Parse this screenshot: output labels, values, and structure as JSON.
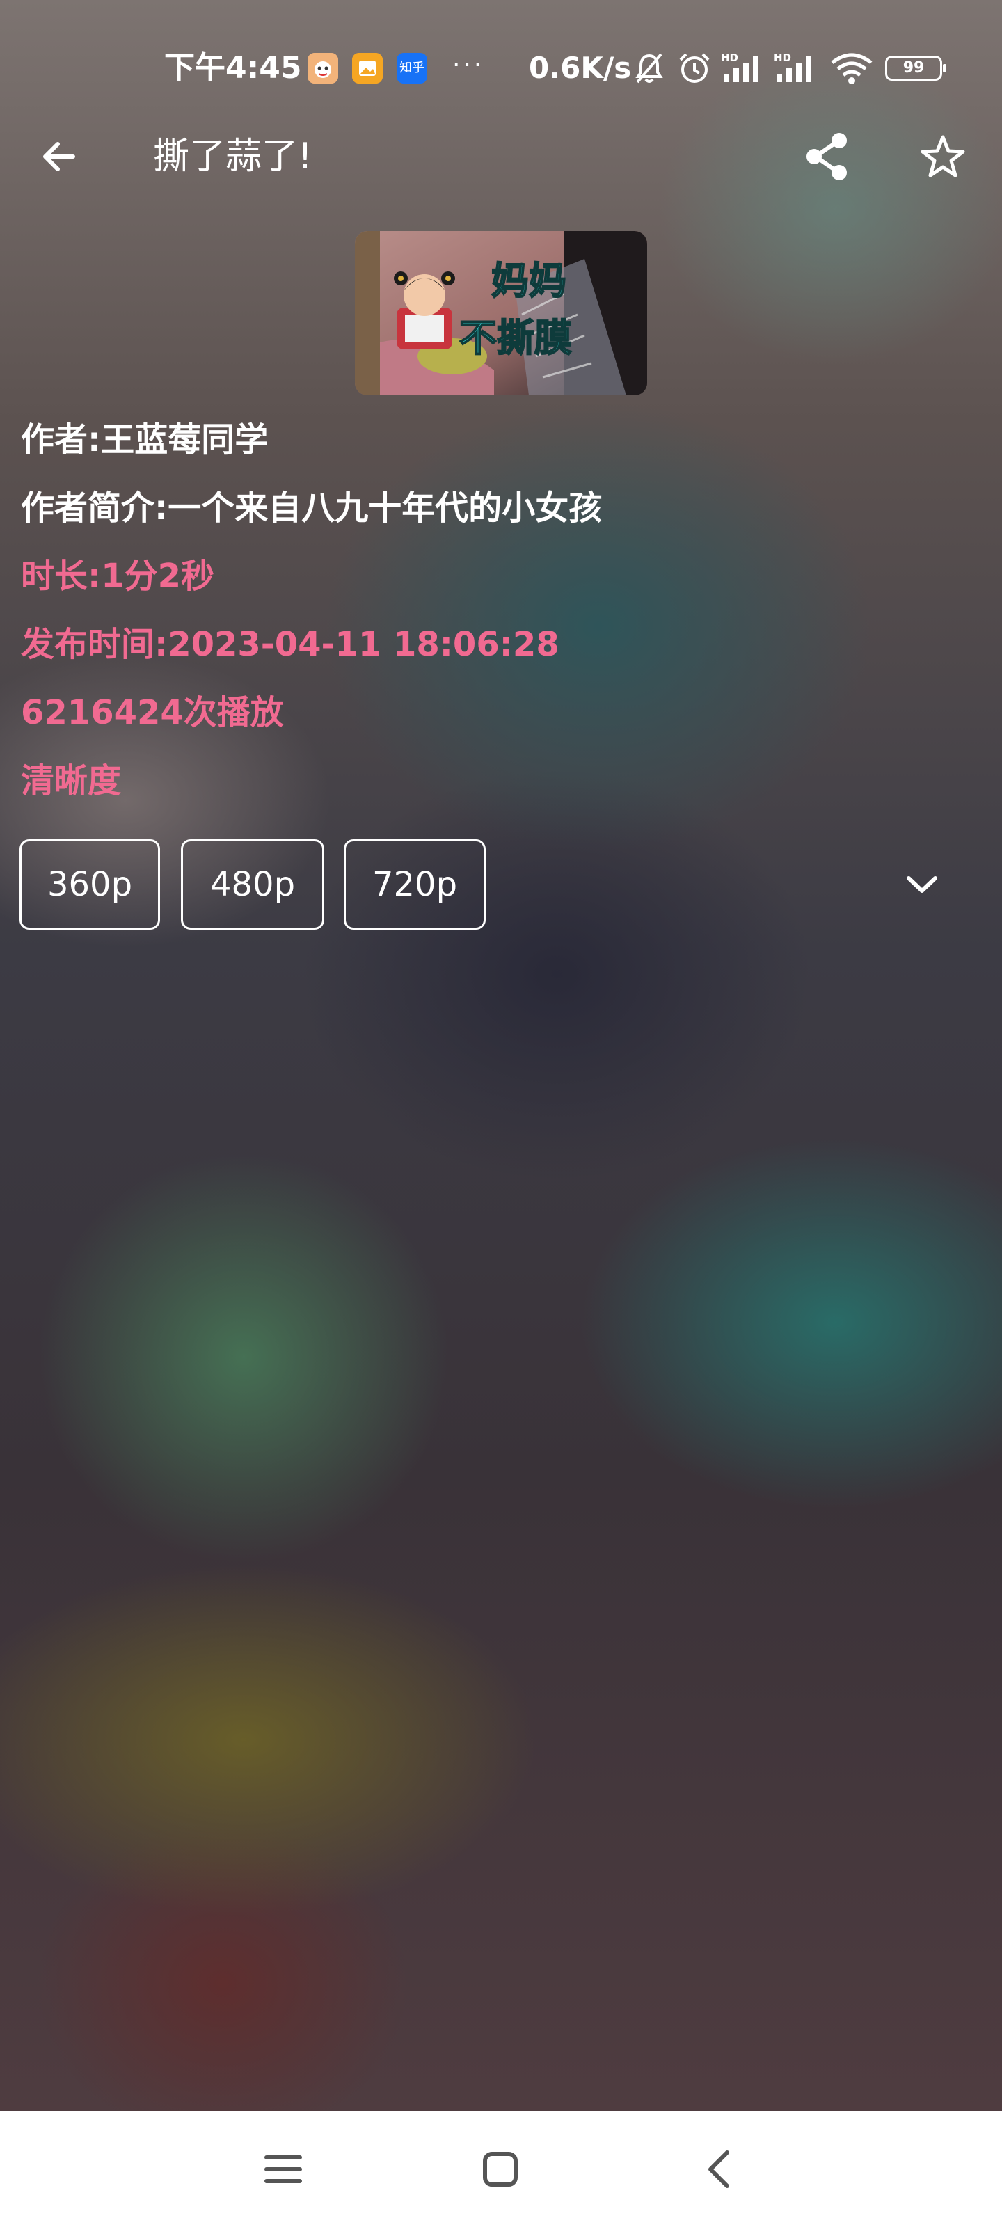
{
  "status_bar": {
    "time": "下午4:45",
    "zhihu_label": "知乎",
    "more": "···",
    "net_speed": "0.6K/s",
    "signal_label_1": "HD",
    "signal_label_2": "HD",
    "battery": "99"
  },
  "header": {
    "title": "撕了蒜了!",
    "icons": [
      "back-arrow-icon",
      "share-icon",
      "star-icon"
    ]
  },
  "thumbnail": {
    "text_line1": "妈妈",
    "text_line2": "不撕膜"
  },
  "details": {
    "author": "作者:王蓝莓同学",
    "author_bio": "作者简介:一个来自八九十年代的小女孩",
    "duration": "时长:1分2秒",
    "publish_time": "发布时间:2023-04-11 18:06:28",
    "play_count": "6216424次播放",
    "quality_heading": "清晰度"
  },
  "quality_options": [
    "360p",
    "480p",
    "720p"
  ],
  "colors": {
    "accent_pink": "#f16a91",
    "text_white": "#ffffff",
    "nav_bg": "#ffffff",
    "nav_icon": "#555555"
  },
  "nav_bar": {
    "icons": [
      "menu-icon",
      "home-square-icon",
      "back-chevron-icon"
    ]
  }
}
